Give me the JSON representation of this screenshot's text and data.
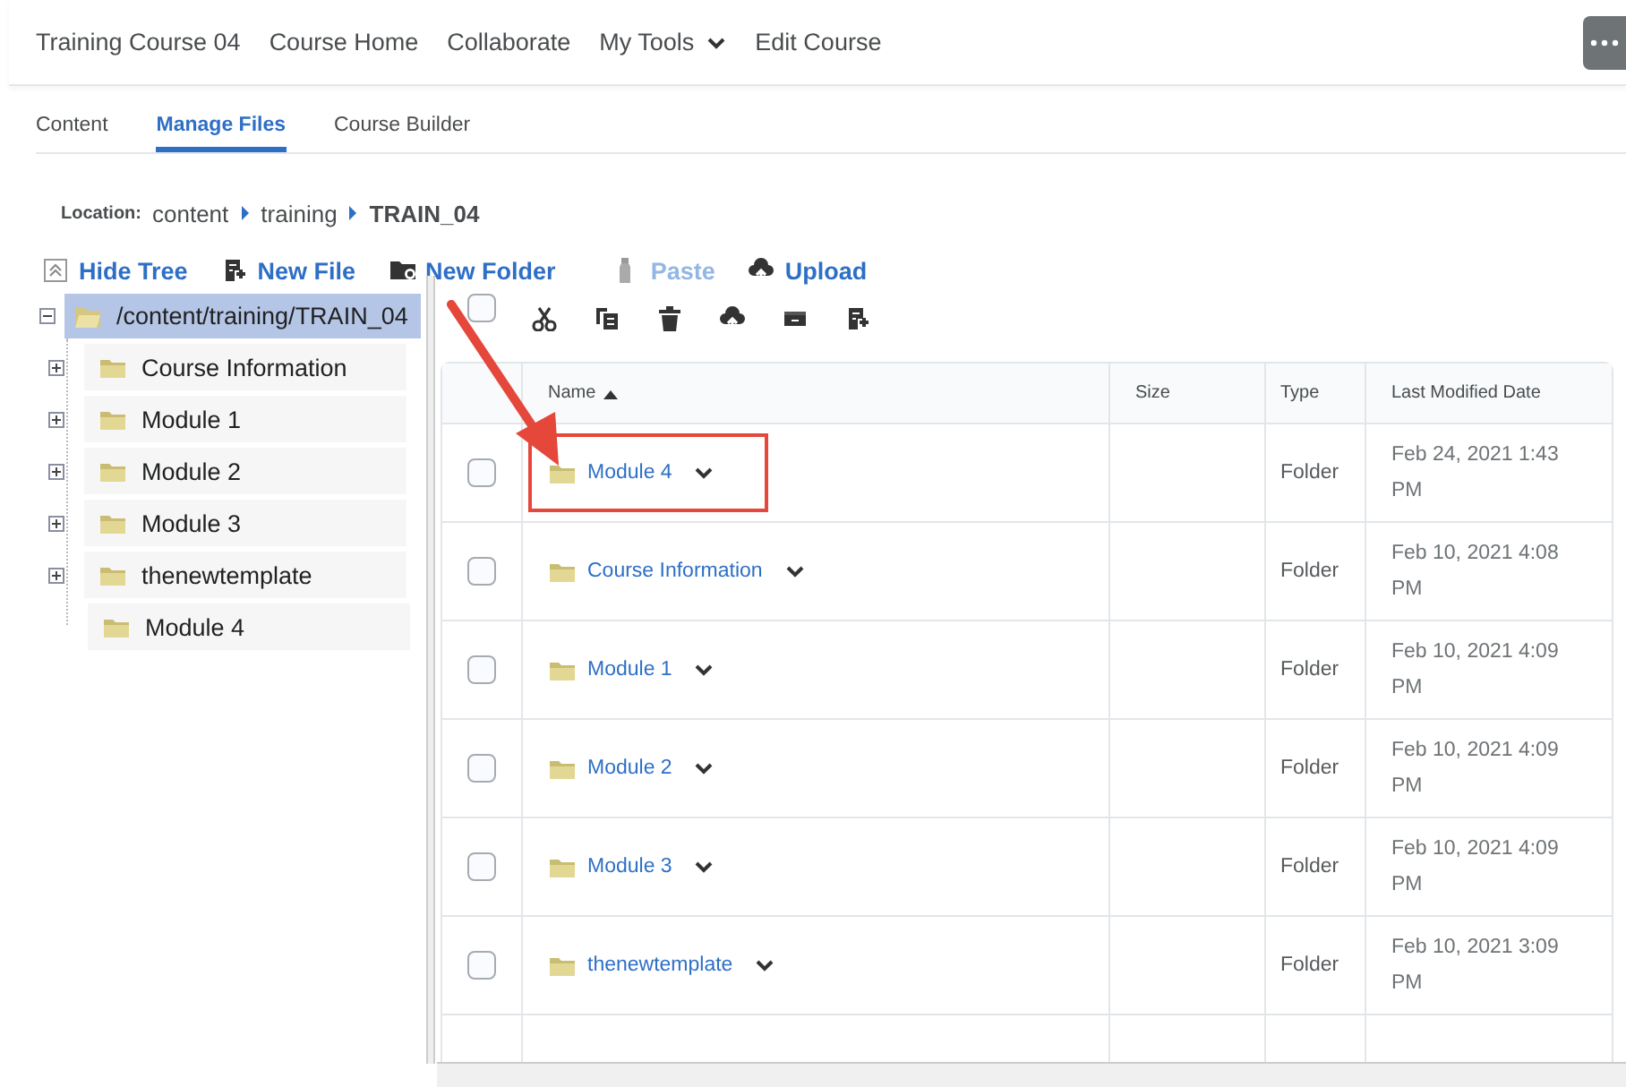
{
  "nav": {
    "items": [
      {
        "label": "Training Course 04",
        "dropdown": false
      },
      {
        "label": "Course Home",
        "dropdown": false
      },
      {
        "label": "Collaborate",
        "dropdown": false
      },
      {
        "label": "My Tools",
        "dropdown": true
      },
      {
        "label": "Edit Course",
        "dropdown": false
      }
    ]
  },
  "tabs": [
    {
      "label": "Content",
      "selected": false
    },
    {
      "label": "Manage Files",
      "selected": true
    },
    {
      "label": "Course Builder",
      "selected": false
    }
  ],
  "location": {
    "label": "Location:",
    "path": [
      {
        "label": "content",
        "current": false
      },
      {
        "label": "training",
        "current": false
      },
      {
        "label": "TRAIN_04",
        "current": true
      }
    ]
  },
  "toolbar": [
    {
      "kind": "hide-tree",
      "label": "Hide Tree",
      "disabled": false
    },
    {
      "kind": "new-file",
      "label": "New File",
      "disabled": false
    },
    {
      "kind": "new-folder",
      "label": "New Folder",
      "disabled": false
    },
    {
      "kind": "paste",
      "label": "Paste",
      "disabled": true
    },
    {
      "kind": "upload",
      "label": "Upload",
      "disabled": false
    }
  ],
  "tree": {
    "label": "/content/training/TRAIN_04",
    "expanded": true,
    "selected": true,
    "children": [
      {
        "label": "Course Information",
        "expandable": true,
        "selected": false
      },
      {
        "label": "Module 1",
        "expandable": true,
        "selected": false
      },
      {
        "label": "Module 2",
        "expandable": true,
        "selected": false
      },
      {
        "label": "Module 3",
        "expandable": true,
        "selected": false
      },
      {
        "label": "thenewtemplate",
        "expandable": true,
        "selected": false
      },
      {
        "label": "Module 4",
        "expandable": false,
        "selected": false
      }
    ]
  },
  "table": {
    "select_all": {
      "checked": false
    },
    "columns": [
      {
        "label": "Name",
        "sorted": true
      },
      {
        "label": "Size",
        "sorted": false
      },
      {
        "label": "Type",
        "sorted": false
      },
      {
        "label": "Last Modified Date",
        "sorted": false
      }
    ],
    "rows": [
      {
        "name": "Module 4",
        "type": "Folder",
        "date": "Feb 24, 2021 1:43 PM",
        "checked": false,
        "highlighted": true
      },
      {
        "name": "Course Information",
        "type": "Folder",
        "date": "Feb 10, 2021 4:08 PM",
        "checked": false,
        "highlighted": false
      },
      {
        "name": "Module 1",
        "type": "Folder",
        "date": "Feb 10, 2021 4:09 PM",
        "checked": false,
        "highlighted": false
      },
      {
        "name": "Module 2",
        "type": "Folder",
        "date": "Feb 10, 2021 4:09 PM",
        "checked": false,
        "highlighted": false
      },
      {
        "name": "Module 3",
        "type": "Folder",
        "date": "Feb 10, 2021 4:09 PM",
        "checked": false,
        "highlighted": false
      },
      {
        "name": "thenewtemplate",
        "type": "Folder",
        "date": "Feb 10, 2021 3:09 PM",
        "checked": false,
        "highlighted": false
      }
    ]
  }
}
